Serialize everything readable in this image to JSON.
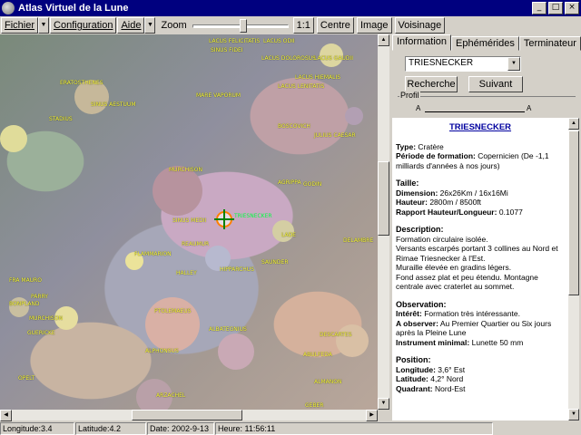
{
  "window": {
    "title": "Atlas Virtuel de la Lune",
    "buttons": [
      "_",
      "□",
      "×"
    ]
  },
  "toolbar": {
    "menus": [
      "Fichier",
      "Configuration",
      "Aide"
    ],
    "zoom_label": "Zoom",
    "buttons": [
      "1:1",
      "Centre",
      "Image",
      "Voisinage"
    ]
  },
  "map": {
    "target_label": "TRIESNECKER",
    "labels": [
      "LACUS FELICITATIS",
      "LACUS ODII",
      "LACUS DOLOROSUS",
      "LACUS GAUDII",
      "SINUS FIDEI",
      "LACUS HIEMALIS",
      "LACUS LENITATIS",
      "ERATOSTHENES",
      "MARE VAPORUM",
      "SINUS AESTUUM",
      "STADIUS",
      "BOSCOVICH",
      "JULIUS CAESAR",
      "MURCHISON",
      "AGRIPPA",
      "GODIN",
      "SINUS MEDII",
      "LADE",
      "DELAMBRE",
      "REAUMUR",
      "FLAMMARION",
      "SAUNDER",
      "HIPPARCHUS",
      "HALLEY",
      "PTOLEMAEUS",
      "ALBATEGNIUS",
      "DESCARTES",
      "ALPHONSUS",
      "ABULFEDA",
      "ALMANON",
      "ARZACHEL",
      "GEBER",
      "FRA MAURO",
      "PARRY",
      "BONPLAND",
      "GUERICKE",
      "OPELT",
      "MURCHISON"
    ]
  },
  "panel": {
    "tabs": [
      "Information",
      "Ephémérides",
      "Terminateur"
    ],
    "selected": "TRIESNECKER",
    "btn_search": "Recherche",
    "btn_next": "Suivant",
    "profil_label": "Profil",
    "profil_a": "A",
    "profil_b": "A",
    "info": {
      "name": "TRIESNECKER",
      "type_label": "Type:",
      "type_value": "Cratère",
      "period_label": "Période de formation:",
      "period_value": "Copernicien (De -1,1 milliards d'années à nos jours)",
      "size_head": "Taille:",
      "dim_label": "Dimension:",
      "dim_value": "26x26Km / 16x16Mi",
      "height_label": "Hauteur:",
      "height_value": "2800m / 8500ft",
      "ratio_label": "Rapport Hauteur/Longueur:",
      "ratio_value": "0.1077",
      "desc_head": "Description:",
      "desc": [
        "Formation circulaire isolée.",
        "Versants escarpés portant 3 collines au Nord et Rimae Triesnecker à l'Est.",
        "Muraille élevée en gradins légers.",
        "Fond assez plat et peu étendu. Montagne centrale avec craterlet au sommet."
      ],
      "obs_head": "Observation:",
      "interest_label": "Intérêt:",
      "interest_value": "Formation très intéressante.",
      "observe_label": "A observer:",
      "observe_value": "Au Premier Quartier ou Six jours après la Pleine Lune",
      "instrument_label": "Instrument minimal:",
      "instrument_value": "Lunette 50 mm",
      "pos_head": "Position:",
      "lon_label": "Longitude:",
      "lon_value": "3,6° Est",
      "lat_label": "Latitude:",
      "lat_value": "4,2° Nord",
      "quad_label": "Quadrant:",
      "quad_value": "Nord-Est"
    }
  },
  "status": {
    "longitude": "Longitude:3.4",
    "latitude": "Latitude:4.2",
    "date": "Date: 2002-9-13",
    "time": "Heure: 11:56:11"
  }
}
